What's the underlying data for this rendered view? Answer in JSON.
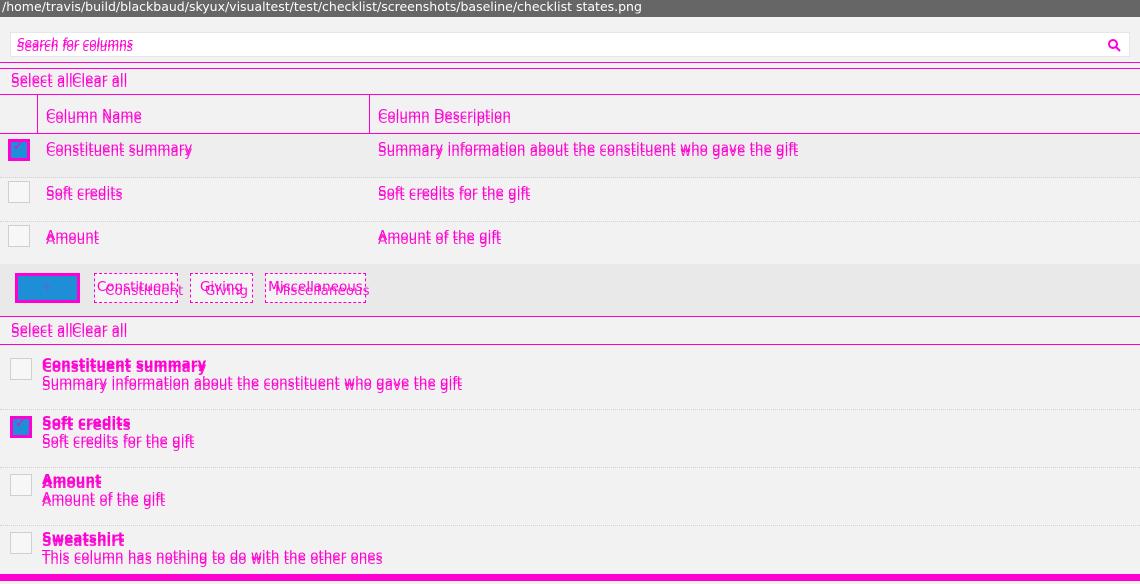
{
  "window": {
    "title": "/home/travis/build/blackbaud/skyux/visualtest/test/checklist/screenshots/baseline/checklist states.png"
  },
  "search": {
    "placeholder": "Search for columns",
    "icon": "search-icon"
  },
  "toolbar_top": {
    "select_all": "Select all",
    "clear_all": "Clear all"
  },
  "grid": {
    "columns": [
      "Column Name",
      "Column Description"
    ],
    "rows": [
      {
        "name": "Constituent summary",
        "description": "Summary information about the constituent who gave the gift",
        "checked": true
      },
      {
        "name": "Soft credits",
        "description": "Soft credits for the gift",
        "checked": false
      },
      {
        "name": "Amount",
        "description": "Amount of the gift",
        "checked": false
      }
    ]
  },
  "filters": {
    "items": [
      {
        "label": "",
        "active": true
      },
      {
        "label": "Constituent",
        "active": false
      },
      {
        "label": "Giving",
        "active": false
      },
      {
        "label": "Miscellaneous",
        "active": false
      }
    ]
  },
  "toolbar_bottom": {
    "select_all": "Select all",
    "clear_all": "Clear all"
  },
  "list": {
    "items": [
      {
        "title": "Constituent summary",
        "description": "Summary information about the constituent who gave the gift",
        "checked": false
      },
      {
        "title": "Soft credits",
        "description": "Soft credits for the gift",
        "checked": true
      },
      {
        "title": "Amount",
        "description": "Amount of the gift",
        "checked": false
      },
      {
        "title": "Sweatshirt",
        "description": "This column has nothing to do with the other ones",
        "checked": false
      }
    ]
  },
  "colors": {
    "accent": "#ff00d2",
    "active_blue": "#1e8fd6",
    "titlebar": "#666666"
  }
}
